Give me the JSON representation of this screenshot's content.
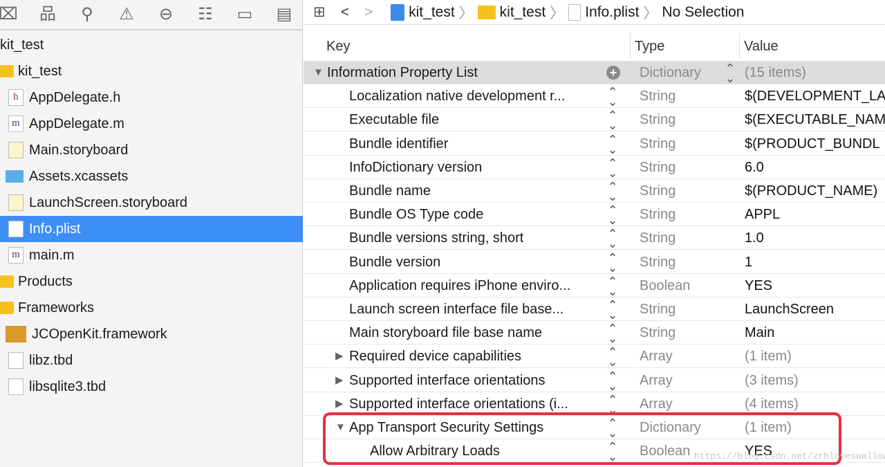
{
  "navigator": {
    "icons": [
      "project-navigator-icon",
      "symbol-navigator-icon",
      "find-navigator-icon",
      "issue-navigator-icon",
      "test-navigator-icon",
      "debug-navigator-icon",
      "breakpoint-navigator-icon",
      "report-navigator-icon"
    ],
    "tree": [
      {
        "label": "kit_test",
        "type": "project",
        "indent": 0
      },
      {
        "label": "kit_test",
        "type": "folder",
        "indent": 0
      },
      {
        "label": "AppDelegate.h",
        "type": "h",
        "indent": 1
      },
      {
        "label": "AppDelegate.m",
        "type": "m",
        "indent": 1
      },
      {
        "label": "Main.storyboard",
        "type": "storyboard",
        "indent": 1
      },
      {
        "label": "Assets.xcassets",
        "type": "assets",
        "indent": 1
      },
      {
        "label": "LaunchScreen.storyboard",
        "type": "storyboard",
        "indent": 1
      },
      {
        "label": "Info.plist",
        "type": "plist",
        "indent": 1,
        "selected": true
      },
      {
        "label": "main.m",
        "type": "m",
        "indent": 1
      },
      {
        "label": "Products",
        "type": "folder",
        "indent": 0
      },
      {
        "label": "Frameworks",
        "type": "folder",
        "indent": 0
      },
      {
        "label": "JCOpenKit.framework",
        "type": "framework",
        "indent": 1
      },
      {
        "label": "libz.tbd",
        "type": "tbd",
        "indent": 1
      },
      {
        "label": "libsqlite3.tbd",
        "type": "tbd",
        "indent": 1
      }
    ]
  },
  "jumpbar": {
    "crumbs": [
      "kit_test",
      "kit_test",
      "Info.plist",
      "No Selection"
    ]
  },
  "plist": {
    "headers": {
      "key": "Key",
      "type": "Type",
      "value": "Value"
    },
    "rows": [
      {
        "key": "Information Property List",
        "type": "Dictionary",
        "value": "(15 items)",
        "level": 0,
        "disclosure": "open",
        "root": true
      },
      {
        "key": "Localization native development r...",
        "type": "String",
        "value": "$(DEVELOPMENT_LA",
        "level": 1
      },
      {
        "key": "Executable file",
        "type": "String",
        "value": "$(EXECUTABLE_NAM",
        "level": 1
      },
      {
        "key": "Bundle identifier",
        "type": "String",
        "value": "$(PRODUCT_BUNDL",
        "level": 1
      },
      {
        "key": "InfoDictionary version",
        "type": "String",
        "value": "6.0",
        "level": 1
      },
      {
        "key": "Bundle name",
        "type": "String",
        "value": "$(PRODUCT_NAME)",
        "level": 1
      },
      {
        "key": "Bundle OS Type code",
        "type": "String",
        "value": "APPL",
        "level": 1
      },
      {
        "key": "Bundle versions string, short",
        "type": "String",
        "value": "1.0",
        "level": 1
      },
      {
        "key": "Bundle version",
        "type": "String",
        "value": "1",
        "level": 1
      },
      {
        "key": "Application requires iPhone enviro...",
        "type": "Boolean",
        "value": "YES",
        "level": 1
      },
      {
        "key": "Launch screen interface file base...",
        "type": "String",
        "value": "LaunchScreen",
        "level": 1
      },
      {
        "key": "Main storyboard file base name",
        "type": "String",
        "value": "Main",
        "level": 1
      },
      {
        "key": "Required device capabilities",
        "type": "Array",
        "value": "(1 item)",
        "level": 1,
        "disclosure": "closed"
      },
      {
        "key": "Supported interface orientations",
        "type": "Array",
        "value": "(3 items)",
        "level": 1,
        "disclosure": "closed"
      },
      {
        "key": "Supported interface orientations (i...",
        "type": "Array",
        "value": "(4 items)",
        "level": 1,
        "disclosure": "closed"
      },
      {
        "key": "App Transport Security Settings",
        "type": "Dictionary",
        "value": "(1 item)",
        "level": 1,
        "disclosure": "open"
      },
      {
        "key": "Allow Arbitrary Loads",
        "type": "Boolean",
        "value": "YES",
        "level": 2
      }
    ]
  },
  "watermark": "https://blog.csdn.net/zrhloveswallow",
  "colors": {
    "selection": "#3e8ef7",
    "highlight": "#e8303f",
    "folder": "#f5c21c"
  }
}
